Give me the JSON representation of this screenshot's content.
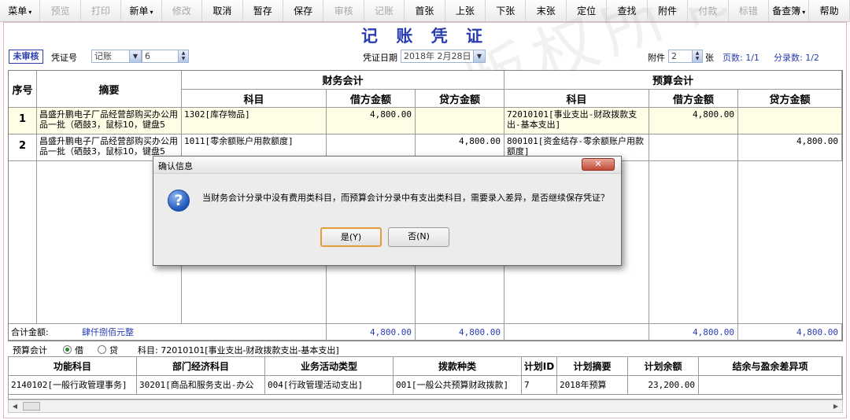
{
  "toolbar": {
    "items": [
      {
        "label": "菜单",
        "enabled": true,
        "dropdown": true
      },
      {
        "label": "预览",
        "enabled": false
      },
      {
        "label": "打印",
        "enabled": false
      },
      {
        "label": "新单",
        "enabled": true,
        "dropdown": true
      },
      {
        "label": "修改",
        "enabled": false
      },
      {
        "label": "取消",
        "enabled": true
      },
      {
        "label": "暂存",
        "enabled": true
      },
      {
        "label": "保存",
        "enabled": true
      },
      {
        "label": "审核",
        "enabled": false
      },
      {
        "label": "记账",
        "enabled": false
      },
      {
        "label": "首张",
        "enabled": true
      },
      {
        "label": "上张",
        "enabled": true
      },
      {
        "label": "下张",
        "enabled": true
      },
      {
        "label": "末张",
        "enabled": true
      },
      {
        "label": "定位",
        "enabled": true
      },
      {
        "label": "查找",
        "enabled": true
      },
      {
        "label": "附件",
        "enabled": true
      },
      {
        "label": "付款",
        "enabled": false
      },
      {
        "label": "标错",
        "enabled": false
      },
      {
        "label": "备查簿",
        "enabled": true,
        "dropdown": true
      },
      {
        "label": "帮助",
        "enabled": true
      }
    ]
  },
  "title": "记 账 凭 证",
  "header": {
    "status": "未审核",
    "voucher_no_label": "凭证号",
    "voucher_type": "记账",
    "voucher_no": "6",
    "date_label": "凭证日期",
    "date_value": "2018年 2月28日",
    "attachment_label": "附件",
    "attachment_count": "2",
    "attachment_unit": "张",
    "page_info": "页数: 1/1",
    "entry_count": "分录数: 1/2"
  },
  "voucher_table": {
    "group_financial": "财务会计",
    "group_budget": "预算会计",
    "col_seq": "序号",
    "col_summary": "摘要",
    "col_account": "科目",
    "col_debit": "借方金额",
    "col_credit": "贷方金额",
    "rows": [
      {
        "seq": "1",
        "summary": "昌盛升鹏电子厂品经营部购买办公用品一批（硒鼓3，鼠标10，键盘5",
        "fin_account": "1302[库存物品]",
        "fin_debit": "4,800.00",
        "fin_credit": "",
        "bud_account": "72010101[事业支出-财政拨款支出-基本支出]",
        "bud_debit": "4,800.00",
        "bud_credit": ""
      },
      {
        "seq": "2",
        "summary": "昌盛升鹏电子厂品经营部购买办公用品一批（硒鼓3，鼠标10，键盘5",
        "fin_account": "1011[零余额账户用款额度]",
        "fin_debit": "",
        "fin_credit": "4,800.00",
        "bud_account": "800101[资金结存-零余额账户用款额度]",
        "bud_debit": "",
        "bud_credit": "4,800.00"
      }
    ],
    "total_label": "合计金额:",
    "total_words": "肆仟捌佰元整",
    "total_fin_debit": "4,800.00",
    "total_fin_credit": "4,800.00",
    "total_bud_debit": "4,800.00",
    "total_bud_credit": "4,800.00"
  },
  "budget_bar": {
    "label": "预算会计",
    "debit_label": "借",
    "credit_label": "贷",
    "selected": "借",
    "account_text": "科目: 72010101[事业支出-财政拨款支出-基本支出]"
  },
  "budget_table": {
    "headers": [
      "功能科目",
      "部门经济科目",
      "业务活动类型",
      "拨款种类",
      "计划ID",
      "计划摘要",
      "计划余额",
      "结余与盈余差异项"
    ],
    "row": [
      "2140102[一般行政管理事务]",
      "30201[商品和服务支出-办公",
      "004[行政管理活动支出]",
      "001[一般公共预算财政拨款]",
      "7",
      "2018年预算",
      "23,200.00",
      ""
    ]
  },
  "dialog": {
    "title": "确认信息",
    "close_icon": "close-icon",
    "question_icon": "question-icon",
    "message": "当财务会计分录中没有费用类科目，而预算会计分录中有支出类科目，需要录入差异，是否继续保存凭证？",
    "yes_label": "是(Y)",
    "no_label": "否(N)"
  },
  "watermark_text": "用友政务公司版权所有"
}
